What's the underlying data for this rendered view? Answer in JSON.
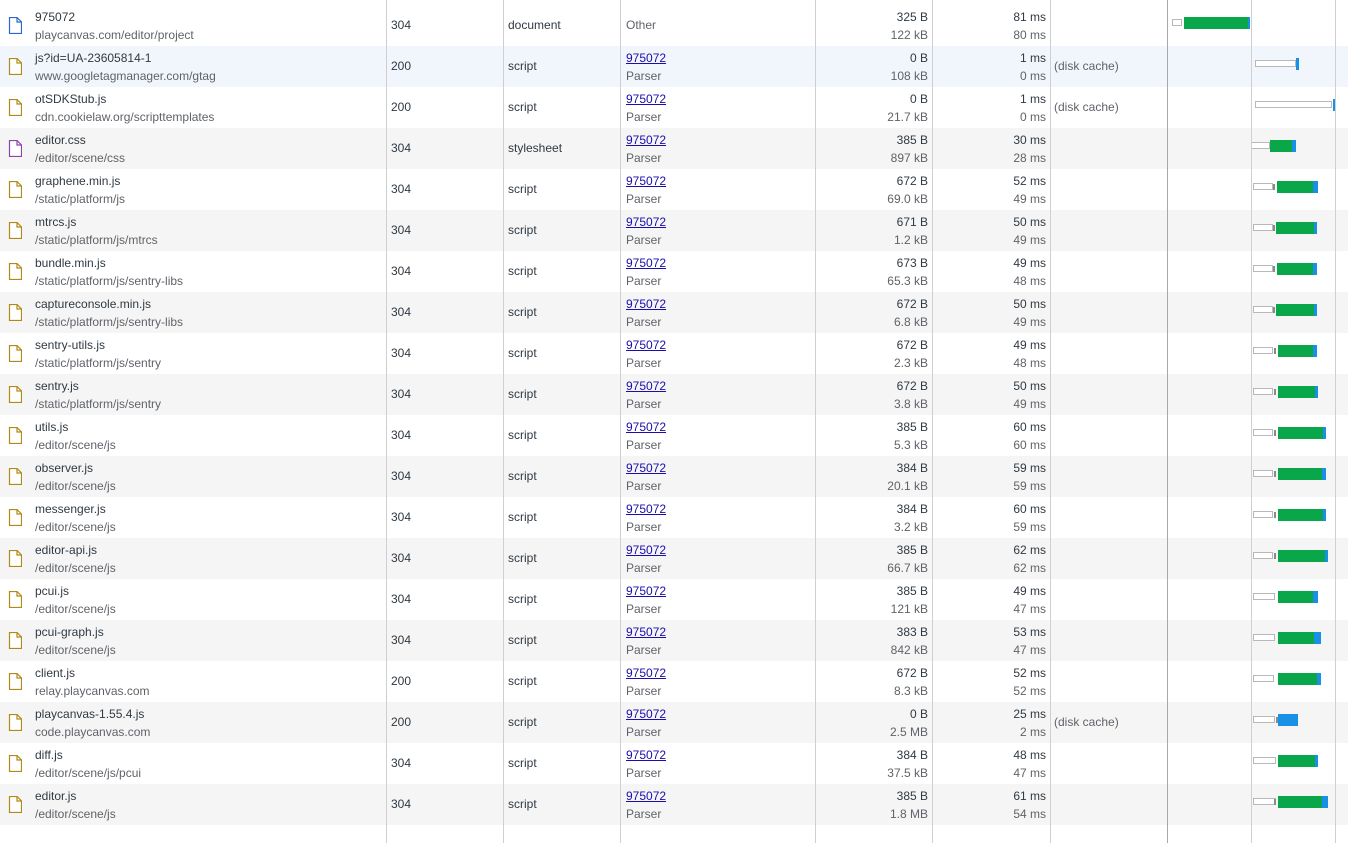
{
  "rows": [
    {
      "name": "975072",
      "path": "playcanvas.com/editor/project",
      "status": "304",
      "type": "document",
      "initiator": "Other",
      "initiator2": "",
      "size1": "325 B",
      "size2": "122 kB",
      "time1": "81 ms",
      "time2": "80 ms",
      "extra": "",
      "icon": "document-file-icon",
      "icon_color": "#2b67d1"
    },
    {
      "name": "js?id=UA-23605814-1",
      "path": "www.googletagmanager.com/gtag",
      "status": "200",
      "type": "script",
      "initiator": "975072",
      "initiator2": "Parser",
      "size1": "0 B",
      "size2": "108 kB",
      "time1": "1 ms",
      "time2": "0 ms",
      "extra": "(disk cache)",
      "icon": "script-file-icon",
      "icon_color": "#b08a19"
    },
    {
      "name": "otSDKStub.js",
      "path": "cdn.cookielaw.org/scripttemplates",
      "status": "200",
      "type": "script",
      "initiator": "975072",
      "initiator2": "Parser",
      "size1": "0 B",
      "size2": "21.7 kB",
      "time1": "1 ms",
      "time2": "0 ms",
      "extra": "(disk cache)",
      "icon": "script-file-icon",
      "icon_color": "#b08a19"
    },
    {
      "name": "editor.css",
      "path": "/editor/scene/css",
      "status": "304",
      "type": "stylesheet",
      "initiator": "975072",
      "initiator2": "Parser",
      "size1": "385 B",
      "size2": "897 kB",
      "time1": "30 ms",
      "time2": "28 ms",
      "extra": "",
      "icon": "stylesheet-file-icon",
      "icon_color": "#8e44ad"
    },
    {
      "name": "graphene.min.js",
      "path": "/static/platform/js",
      "status": "304",
      "type": "script",
      "initiator": "975072",
      "initiator2": "Parser",
      "size1": "672 B",
      "size2": "69.0 kB",
      "time1": "52 ms",
      "time2": "49 ms",
      "extra": "",
      "icon": "script-file-icon",
      "icon_color": "#b08a19"
    },
    {
      "name": "mtrcs.js",
      "path": "/static/platform/js/mtrcs",
      "status": "304",
      "type": "script",
      "initiator": "975072",
      "initiator2": "Parser",
      "size1": "671 B",
      "size2": "1.2 kB",
      "time1": "50 ms",
      "time2": "49 ms",
      "extra": "",
      "icon": "script-file-icon",
      "icon_color": "#b08a19"
    },
    {
      "name": "bundle.min.js",
      "path": "/static/platform/js/sentry-libs",
      "status": "304",
      "type": "script",
      "initiator": "975072",
      "initiator2": "Parser",
      "size1": "673 B",
      "size2": "65.3 kB",
      "time1": "49 ms",
      "time2": "48 ms",
      "extra": "",
      "icon": "script-file-icon",
      "icon_color": "#b08a19"
    },
    {
      "name": "captureconsole.min.js",
      "path": "/static/platform/js/sentry-libs",
      "status": "304",
      "type": "script",
      "initiator": "975072",
      "initiator2": "Parser",
      "size1": "672 B",
      "size2": "6.8 kB",
      "time1": "50 ms",
      "time2": "49 ms",
      "extra": "",
      "icon": "script-file-icon",
      "icon_color": "#b08a19"
    },
    {
      "name": "sentry-utils.js",
      "path": "/static/platform/js/sentry",
      "status": "304",
      "type": "script",
      "initiator": "975072",
      "initiator2": "Parser",
      "size1": "672 B",
      "size2": "2.3 kB",
      "time1": "49 ms",
      "time2": "48 ms",
      "extra": "",
      "icon": "script-file-icon",
      "icon_color": "#b08a19"
    },
    {
      "name": "sentry.js",
      "path": "/static/platform/js/sentry",
      "status": "304",
      "type": "script",
      "initiator": "975072",
      "initiator2": "Parser",
      "size1": "672 B",
      "size2": "3.8 kB",
      "time1": "50 ms",
      "time2": "49 ms",
      "extra": "",
      "icon": "script-file-icon",
      "icon_color": "#b08a19"
    },
    {
      "name": "utils.js",
      "path": "/editor/scene/js",
      "status": "304",
      "type": "script",
      "initiator": "975072",
      "initiator2": "Parser",
      "size1": "385 B",
      "size2": "5.3 kB",
      "time1": "60 ms",
      "time2": "60 ms",
      "extra": "",
      "icon": "script-file-icon",
      "icon_color": "#b08a19"
    },
    {
      "name": "observer.js",
      "path": "/editor/scene/js",
      "status": "304",
      "type": "script",
      "initiator": "975072",
      "initiator2": "Parser",
      "size1": "384 B",
      "size2": "20.1 kB",
      "time1": "59 ms",
      "time2": "59 ms",
      "extra": "",
      "icon": "script-file-icon",
      "icon_color": "#b08a19"
    },
    {
      "name": "messenger.js",
      "path": "/editor/scene/js",
      "status": "304",
      "type": "script",
      "initiator": "975072",
      "initiator2": "Parser",
      "size1": "384 B",
      "size2": "3.2 kB",
      "time1": "60 ms",
      "time2": "59 ms",
      "extra": "",
      "icon": "script-file-icon",
      "icon_color": "#b08a19"
    },
    {
      "name": "editor-api.js",
      "path": "/editor/scene/js",
      "status": "304",
      "type": "script",
      "initiator": "975072",
      "initiator2": "Parser",
      "size1": "385 B",
      "size2": "66.7 kB",
      "time1": "62 ms",
      "time2": "62 ms",
      "extra": "",
      "icon": "script-file-icon",
      "icon_color": "#b08a19"
    },
    {
      "name": "pcui.js",
      "path": "/editor/scene/js",
      "status": "304",
      "type": "script",
      "initiator": "975072",
      "initiator2": "Parser",
      "size1": "385 B",
      "size2": "121 kB",
      "time1": "49 ms",
      "time2": "47 ms",
      "extra": "",
      "icon": "script-file-icon",
      "icon_color": "#b08a19"
    },
    {
      "name": "pcui-graph.js",
      "path": "/editor/scene/js",
      "status": "304",
      "type": "script",
      "initiator": "975072",
      "initiator2": "Parser",
      "size1": "383 B",
      "size2": "842 kB",
      "time1": "53 ms",
      "time2": "47 ms",
      "extra": "",
      "icon": "script-file-icon",
      "icon_color": "#b08a19"
    },
    {
      "name": "client.js",
      "path": "relay.playcanvas.com",
      "status": "200",
      "type": "script",
      "initiator": "975072",
      "initiator2": "Parser",
      "size1": "672 B",
      "size2": "8.3 kB",
      "time1": "52 ms",
      "time2": "52 ms",
      "extra": "",
      "icon": "script-file-icon",
      "icon_color": "#b08a19"
    },
    {
      "name": "playcanvas-1.55.4.js",
      "path": "code.playcanvas.com",
      "status": "200",
      "type": "script",
      "initiator": "975072",
      "initiator2": "Parser",
      "size1": "0 B",
      "size2": "2.5 MB",
      "time1": "25 ms",
      "time2": "2 ms",
      "extra": "(disk cache)",
      "icon": "script-file-icon",
      "icon_color": "#b08a19"
    },
    {
      "name": "diff.js",
      "path": "/editor/scene/js/pcui",
      "status": "304",
      "type": "script",
      "initiator": "975072",
      "initiator2": "Parser",
      "size1": "384 B",
      "size2": "37.5 kB",
      "time1": "48 ms",
      "time2": "47 ms",
      "extra": "",
      "icon": "script-file-icon",
      "icon_color": "#b08a19"
    },
    {
      "name": "editor.js",
      "path": "/editor/scene/js",
      "status": "304",
      "type": "script",
      "initiator": "975072",
      "initiator2": "Parser",
      "size1": "385 B",
      "size2": "1.8 MB",
      "time1": "61 ms",
      "time2": "54 ms",
      "extra": "",
      "icon": "script-file-icon",
      "icon_color": "#b08a19"
    }
  ],
  "colors": {
    "waiting": "#0aa64a",
    "download": "#1a8fe6",
    "link": "#1a0dab",
    "selected_row": "#f1f6fd"
  }
}
